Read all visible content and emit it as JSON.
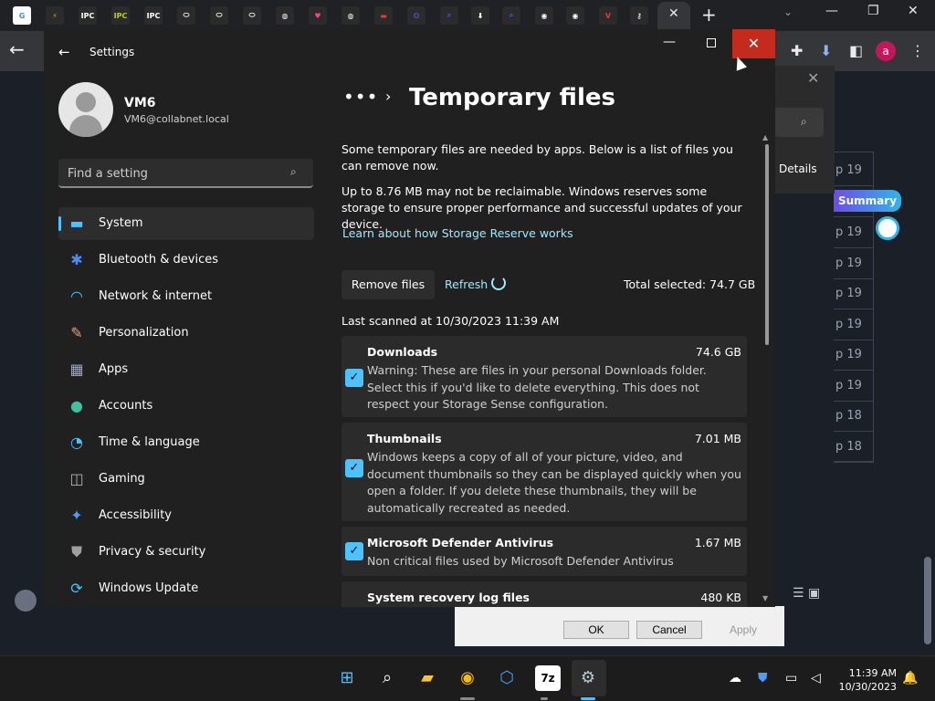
{
  "browser": {
    "tab_icons": [
      {
        "name": "google",
        "text": "G",
        "color": "#ffffff",
        "fg": "#4285f4"
      },
      {
        "name": "ext",
        "text": "⚡",
        "color": "#2b2b2b",
        "fg": "#ff9800"
      },
      {
        "name": "ipc-games-1",
        "text": "IPC",
        "color": "#2b2b2b",
        "fg": "#ffffff"
      },
      {
        "name": "ipc-games-2",
        "text": "IPC",
        "color": "#2b2b2b",
        "fg": "#c0ca33"
      },
      {
        "name": "ipc-games-3",
        "text": "IPC",
        "color": "#2b2b2b",
        "fg": "#ffffff"
      },
      {
        "name": "pill-1",
        "text": "⬭",
        "color": "#2b2b2b",
        "fg": "#ffffff"
      },
      {
        "name": "pill-2",
        "text": "⬭",
        "color": "#2b2b2b",
        "fg": "#ffffff"
      },
      {
        "name": "pill-3",
        "text": "⬭",
        "color": "#2b2b2b",
        "fg": "#ffffff"
      },
      {
        "name": "globe-1",
        "text": "◍",
        "color": "#2b2b2b",
        "fg": "#ffffff"
      },
      {
        "name": "heart",
        "text": "♥",
        "color": "#2b2b2b",
        "fg": "#ff4081"
      },
      {
        "name": "globe-2",
        "text": "◍",
        "color": "#2b2b2b",
        "fg": "#ffffff"
      },
      {
        "name": "red-pill",
        "text": "▬",
        "color": "#2b2b2b",
        "fg": "#e53935"
      },
      {
        "name": "search-o",
        "text": "O",
        "color": "#2b2b2b",
        "fg": "#3f51b5"
      },
      {
        "name": "search-1",
        "text": "⌕",
        "color": "#2b2b2b",
        "fg": "#2962ff"
      },
      {
        "name": "download",
        "text": "⬇",
        "color": "#2b2b2b",
        "fg": "#ffffff"
      },
      {
        "name": "search-2",
        "text": "⌕",
        "color": "#2b2b2b",
        "fg": "#2962ff"
      },
      {
        "name": "chrome-1",
        "text": "◉",
        "color": "#2b2b2b",
        "fg": "#ffffff"
      },
      {
        "name": "chrome-2",
        "text": "◉",
        "color": "#2b2b2b",
        "fg": "#ffffff"
      },
      {
        "name": "vivaldi",
        "text": "V",
        "color": "#2b2b2b",
        "fg": "#e53935"
      },
      {
        "name": "key",
        "text": "⚷",
        "color": "#2b2b2b",
        "fg": "#ffffff"
      }
    ],
    "avatar_letter": "a"
  },
  "background_page": {
    "row_labels": [
      "p 19",
      "p 19",
      "p 19",
      "p 19",
      "p 19",
      "p 19",
      "p 19",
      "p 19",
      "p 18",
      "p 18"
    ],
    "summary_label": "Summary"
  },
  "dialog": {
    "details_label": "Details",
    "ok_label": "OK",
    "cancel_label": "Cancel",
    "apply_label": "Apply"
  },
  "settings": {
    "window_title": "Settings",
    "user": {
      "name": "VM6",
      "email": "VM6@collabnet.local"
    },
    "search_placeholder": "Find a setting",
    "nav": [
      {
        "label": "System",
        "icon": "system-icon",
        "glyph": "▬",
        "color": "#4cc2ff",
        "selected": true
      },
      {
        "label": "Bluetooth & devices",
        "icon": "bluetooth-icon",
        "glyph": "✱",
        "color": "#4c8cff",
        "selected": false
      },
      {
        "label": "Network & internet",
        "icon": "wifi-icon",
        "glyph": "◠",
        "color": "#4cc2ff",
        "selected": false
      },
      {
        "label": "Personalization",
        "icon": "brush-icon",
        "glyph": "✎",
        "color": "#f0a070",
        "selected": false
      },
      {
        "label": "Apps",
        "icon": "apps-icon",
        "glyph": "▦",
        "color": "#a0a8c0",
        "selected": false
      },
      {
        "label": "Accounts",
        "icon": "accounts-icon",
        "glyph": "●",
        "color": "#3fc1a0",
        "selected": false
      },
      {
        "label": "Time & language",
        "icon": "globe-clock-icon",
        "glyph": "◔",
        "color": "#4cc2ff",
        "selected": false
      },
      {
        "label": "Gaming",
        "icon": "gamepad-icon",
        "glyph": "◫",
        "color": "#b0b0b0",
        "selected": false
      },
      {
        "label": "Accessibility",
        "icon": "accessibility-icon",
        "glyph": "✦",
        "color": "#4c9cff",
        "selected": false
      },
      {
        "label": "Privacy & security",
        "icon": "shield-icon",
        "glyph": "⛊",
        "color": "#a0a0a0",
        "selected": false
      },
      {
        "label": "Windows Update",
        "icon": "update-icon",
        "glyph": "⟳",
        "color": "#4cc2ff",
        "selected": false
      }
    ],
    "page": {
      "breadcrumb_dots": "•••",
      "title": "Temporary files",
      "intro": "Some temporary files are needed by apps. Below is a list of files you can remove now.",
      "reserve_note": "Up to 8.76 MB may not be reclaimable. Windows reserves some storage to ensure proper performance and successful updates of your device.",
      "learn_link": "Learn about how Storage Reserve works",
      "remove_label": "Remove files",
      "refresh_label": "Refresh",
      "total_selected": "Total selected: 74.7 GB",
      "last_scanned": "Last scanned at 10/30/2023 11:39 AM",
      "files": [
        {
          "name": "Downloads",
          "size": "74.6 GB",
          "checked": true,
          "desc": "Warning: These are files in your personal Downloads folder. Select this if you'd like to delete everything. This does not respect your Storage Sense configuration."
        },
        {
          "name": "Thumbnails",
          "size": "7.01 MB",
          "checked": true,
          "desc": "Windows keeps a copy of all of your picture, video, and document thumbnails so they can be displayed quickly when you open a folder. If you delete these thumbnails, they will be automatically recreated as needed."
        },
        {
          "name": "Microsoft Defender Antivirus",
          "size": "1.67 MB",
          "checked": true,
          "desc": "Non critical files used by Microsoft Defender Antivirus"
        },
        {
          "name": "System recovery log files",
          "size": "480 KB",
          "checked": true,
          "desc": ""
        }
      ]
    }
  },
  "taskbar": {
    "clock_time": "11:39 AM",
    "clock_date": "10/30/2023"
  },
  "colors": {
    "accent": "#4cc2ff",
    "close_red": "#c42b1c",
    "link": "#99ebff"
  }
}
